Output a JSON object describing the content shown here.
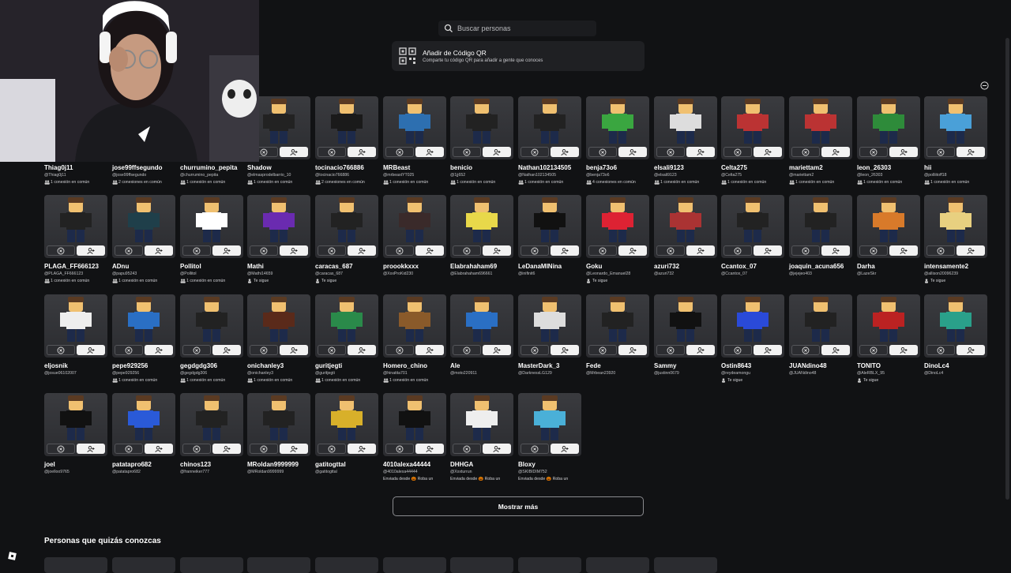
{
  "search": {
    "placeholder": "Buscar personas"
  },
  "qr": {
    "title": "Añadir de Código QR",
    "subtitle": "Comparte tu código QR para añadir a gente que conoces"
  },
  "friends": [
    {
      "name": "Thiag0j11",
      "user": "@Thiag0j11",
      "status": "1 conexión en común",
      "st": "c",
      "c": "#2a6fc4"
    },
    {
      "name": "jose99ffsegundo",
      "user": "@jose99ffsegundo",
      "status": "2 conexiones en común",
      "st": "c",
      "c": "#222"
    },
    {
      "name": "churrumino_pepita",
      "user": "@churrumino_pepita",
      "status": "1 conexión en común",
      "st": "c",
      "c": "#222"
    },
    {
      "name": "Shadow",
      "user": "@elmasprodelbarrio_10",
      "status": "1 conexión en común",
      "st": "c",
      "c": "#222"
    },
    {
      "name": "tocinacio766886",
      "user": "@tocinacio766886",
      "status": "2 conexiones en común",
      "st": "c",
      "c": "#1a1a1a"
    },
    {
      "name": "MRBeast",
      "user": "@mrbeastYT025",
      "status": "1 conexión en común",
      "st": "c",
      "c": "#2d6fb0"
    },
    {
      "name": "benicio",
      "user": "@1jj652",
      "status": "1 conexión en común",
      "st": "c",
      "c": "#222"
    },
    {
      "name": "Nathan102134505",
      "user": "@Nathan102134505",
      "status": "1 conexión en común",
      "st": "c",
      "c": "#222"
    },
    {
      "name": "benja73o6",
      "user": "@benja73o6",
      "status": "4 conexiones en común",
      "st": "c",
      "c": "#3aa640"
    },
    {
      "name": "elsali9123",
      "user": "@elsali9123",
      "status": "1 conexión en común",
      "st": "c",
      "c": "#ddd"
    },
    {
      "name": "Celta275",
      "user": "@Celta275",
      "status": "1 conexión en común",
      "st": "c",
      "c": "#b33"
    },
    {
      "name": "mariettam2",
      "user": "@mariettam2",
      "status": "1 conexión en común",
      "st": "c",
      "c": "#b33"
    },
    {
      "name": "leon_26303",
      "user": "@leon_26303",
      "status": "1 conexión en común",
      "st": "c",
      "c": "#2e8b3a"
    },
    {
      "name": "hii",
      "user": "@polliitoff18",
      "status": "1 conexión en común",
      "st": "c",
      "c": "#4aa0d8"
    },
    {
      "name": "PLAGA_FF666123",
      "user": "@PLAGA_FF666123",
      "status": "1 conexión en común",
      "st": "c",
      "c": "#222"
    },
    {
      "name": "ADnu",
      "user": "@papu95243",
      "status": "1 conexión en común",
      "st": "c",
      "c": "#1f3f4a"
    },
    {
      "name": "Pollitol",
      "user": "@Pollitol",
      "status": "1 conexión en común",
      "st": "c",
      "c": "#fff"
    },
    {
      "name": "Mathi",
      "user": "@Mathi14659",
      "status": "Te sigue",
      "st": "f",
      "c": "#6a2bb0"
    },
    {
      "name": "caracas_687",
      "user": "@caracas_687",
      "status": "Te sigue",
      "st": "f",
      "c": "#222"
    },
    {
      "name": "proookkxxx",
      "user": "@XxxProKid230",
      "status": "",
      "st": "",
      "c": "#3a2a2a"
    },
    {
      "name": "Elabrahaham69",
      "user": "@Elabrahaham696661",
      "status": "",
      "st": "",
      "c": "#e8d84a"
    },
    {
      "name": "LeDanaMINina",
      "user": "@inifinit6",
      "status": "",
      "st": "",
      "c": "#111"
    },
    {
      "name": "Goku",
      "user": "@Leonardo_Emanuel28",
      "status": "Te sigue",
      "st": "f",
      "c": "#d23"
    },
    {
      "name": "azuri732",
      "user": "@azuri732",
      "status": "",
      "st": "",
      "c": "#a33"
    },
    {
      "name": "Ccantox_07",
      "user": "@Ccantox_07",
      "status": "",
      "st": "",
      "c": "#222"
    },
    {
      "name": "joaquin_acuna656",
      "user": "@jejejeo403",
      "status": "",
      "st": "",
      "c": "#222"
    },
    {
      "name": "Darha",
      "user": "@LazeSkr",
      "status": "",
      "st": "",
      "c": "#d87a2a"
    },
    {
      "name": "intensamente2",
      "user": "@allison20096239",
      "status": "Te sigue",
      "st": "f",
      "c": "#e8d080"
    },
    {
      "name": "eljosnik",
      "user": "@josue06102007",
      "status": "",
      "st": "",
      "c": "#eee"
    },
    {
      "name": "pepe929256",
      "user": "@pepe929256",
      "status": "1 conexión en común",
      "st": "c",
      "c": "#2a6fc4"
    },
    {
      "name": "gegdgdg306",
      "user": "@gegdgdg306",
      "status": "1 conexión en común",
      "st": "c",
      "c": "#222"
    },
    {
      "name": "onichanley3",
      "user": "@onichanley3",
      "status": "1 conexión en común",
      "st": "c",
      "c": "#5a2a1a"
    },
    {
      "name": "guritjegti",
      "user": "@guritjegti",
      "status": "1 conexión en común",
      "st": "c",
      "c": "#2a8a4a"
    },
    {
      "name": "Homero_chino",
      "user": "@hinatita701",
      "status": "1 conexión en común",
      "st": "c",
      "c": "#8a5a2a"
    },
    {
      "name": "Ale",
      "user": "@moto220911",
      "status": "",
      "st": "",
      "c": "#2a6fc4"
    },
    {
      "name": "MasterDark_3",
      "user": "@DarknessLG129",
      "status": "",
      "st": "",
      "c": "#ddd"
    },
    {
      "name": "Fede",
      "user": "@Mrbean23920",
      "status": "",
      "st": "",
      "c": "#222"
    },
    {
      "name": "Sammy",
      "user": "@justinn0679",
      "status": "",
      "st": "",
      "c": "#111"
    },
    {
      "name": "Ostin8643",
      "user": "@reydeamongu",
      "status": "Te sigue",
      "st": "f",
      "c": "#2a4ad8"
    },
    {
      "name": "JUANdino48",
      "user": "@JUANdino48",
      "status": "",
      "st": "",
      "c": "#222"
    },
    {
      "name": "TONITO",
      "user": "@AleRBLX_95",
      "status": "Te sigue",
      "st": "f",
      "c": "#b22"
    },
    {
      "name": "DinoLc4",
      "user": "@DinoLc4",
      "status": "",
      "st": "",
      "c": "#2aa08a"
    },
    {
      "name": "joel",
      "user": "@joelloo9765",
      "status": "",
      "st": "",
      "c": "#111"
    },
    {
      "name": "patatapro682",
      "user": "@patatapro682",
      "status": "",
      "st": "",
      "c": "#2a5ad8"
    },
    {
      "name": "chinos123",
      "user": "@franneiker777",
      "status": "",
      "st": "",
      "c": "#222"
    },
    {
      "name": "MRoldan9999999",
      "user": "@MRoldan9999999",
      "status": "",
      "st": "",
      "c": "#222"
    },
    {
      "name": "gatitogttal",
      "user": "@gatitogttal",
      "status": "",
      "st": "",
      "c": "#d8b02a"
    },
    {
      "name": "4010alexa44444",
      "user": "@4010alexa44444",
      "status": "Enviada desde 🎃 Roba un",
      "st": "",
      "c": "#111"
    },
    {
      "name": "DHHGA",
      "user": "@Xxxturrun",
      "status": "Enviada desde 🎃 Roba un",
      "st": "",
      "c": "#eee"
    },
    {
      "name": "Bloxy",
      "user": "@SKIBIDIM752",
      "status": "Enviada desde 🎃 Roba un",
      "st": "",
      "c": "#4ab0d8"
    }
  ],
  "show_more_label": "Mostrar más",
  "suggested_heading": "Personas que quizás conozcas"
}
